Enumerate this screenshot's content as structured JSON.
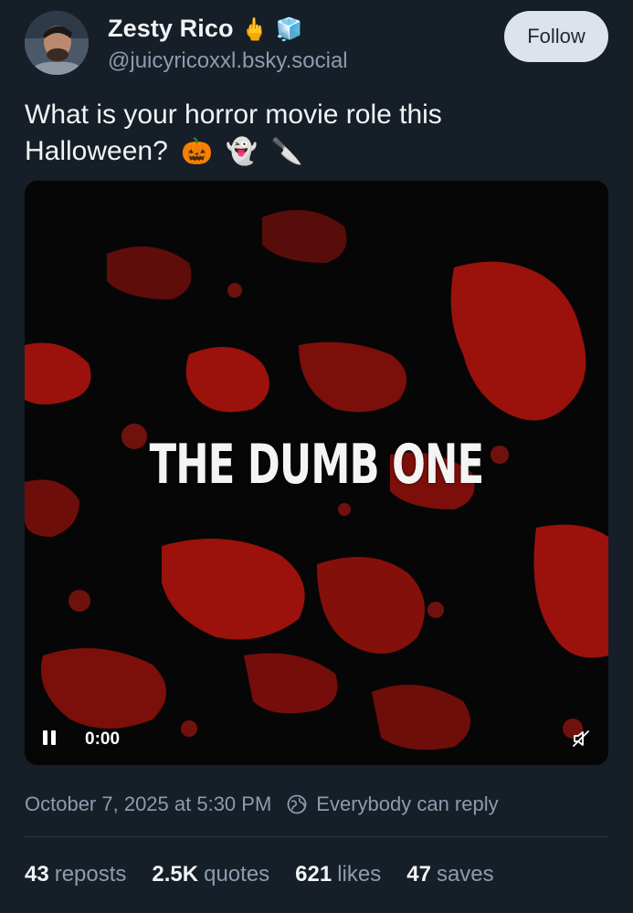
{
  "author": {
    "display_name": "Zesty Rico",
    "name_emojis": [
      "🖕",
      "🧊"
    ],
    "handle": "@juicyricoxxl.bsky.social",
    "avatar_icon": "user-avatar"
  },
  "follow_label": "Follow",
  "post": {
    "text": "What is your horror movie role this Halloween?",
    "emojis": [
      "🎃",
      "👻",
      "🔪"
    ]
  },
  "video": {
    "overlay_text": "THE DUMB ONE",
    "time": "0:00",
    "pause_icon": "pause-icon",
    "mute_icon": "mute-icon",
    "blood_color": "#b0170f"
  },
  "meta": {
    "timestamp": "October 7, 2025 at 5:30 PM",
    "reply_setting": "Everybody can reply"
  },
  "stats": [
    {
      "count": "43",
      "label": "reposts"
    },
    {
      "count": "2.5K",
      "label": "quotes"
    },
    {
      "count": "621",
      "label": "likes"
    },
    {
      "count": "47",
      "label": "saves"
    }
  ]
}
